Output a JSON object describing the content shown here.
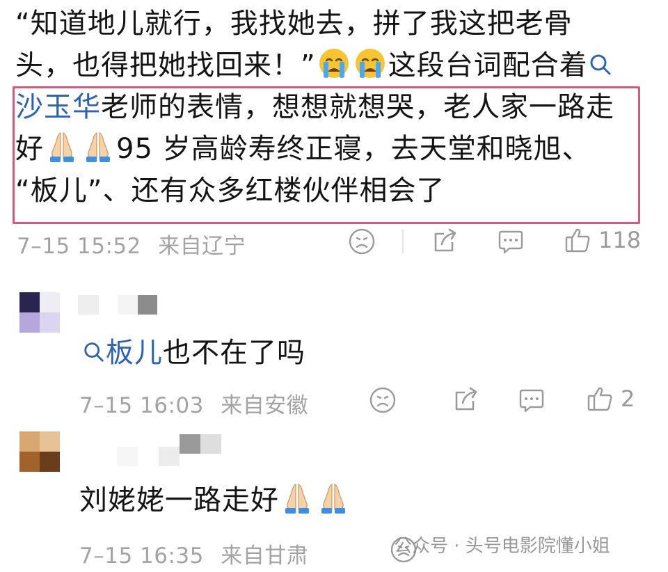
{
  "main_comment": {
    "line1": "“知道地儿就行，我找她去，拼了我这把老骨",
    "line2": "头，也得把她找回来！”",
    "line2_tail": "这段台词配合着",
    "line3_topic": "沙玉华",
    "line3_rest": "老师的表情，想想就想哭，老人家一路走",
    "line4_a": "好",
    "line4_b": "95 岁高龄寿终正寝，去天堂和晓旭、",
    "line5": "“板儿”、还有众多红楼伙伴相会了",
    "timestamp": "7–15 15:52",
    "location": "来自辽宁",
    "like_count": "118"
  },
  "replies": [
    {
      "topic": "板儿",
      "text": "也不在了吗",
      "timestamp": "7–15 16:03",
      "location": "来自安徽",
      "like_count": "2"
    },
    {
      "text": "刘姥姥一路走好",
      "timestamp": "7–15 16:35",
      "location": "来自甘肃"
    }
  ],
  "watermark": {
    "text": "公众号 · 头号电影院懂小姐"
  },
  "colors": {
    "topic_blue": "#2f63ad",
    "highlight_border": "#d9577c",
    "meta_gray": "#a3a3a3"
  },
  "icons": [
    "crying-face-icon",
    "praying-hands-icon",
    "search-icon",
    "sad-face-icon",
    "share-icon",
    "comment-icon",
    "thumbs-up-icon"
  ]
}
